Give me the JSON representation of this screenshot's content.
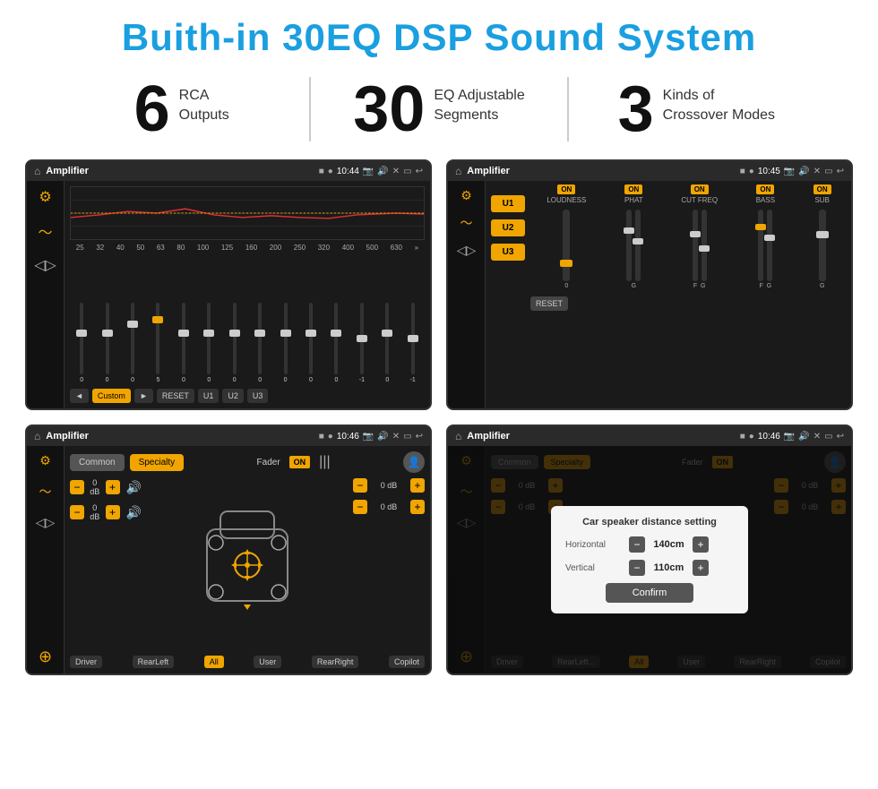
{
  "title": "Buith-in 30EQ DSP Sound System",
  "stats": [
    {
      "number": "6",
      "label": "RCA\nOutputs"
    },
    {
      "number": "30",
      "label": "EQ Adjustable\nSegments"
    },
    {
      "number": "3",
      "label": "Kinds of\nCrossover Modes"
    }
  ],
  "screens": [
    {
      "id": "eq-screen",
      "statusBar": {
        "appTitle": "Amplifier",
        "time": "10:44"
      },
      "eqBands": [
        "25",
        "32",
        "40",
        "50",
        "63",
        "80",
        "100",
        "125",
        "160",
        "200",
        "250",
        "320",
        "400",
        "500",
        "630"
      ],
      "eqValues": [
        "0",
        "0",
        "0",
        "5",
        "0",
        "0",
        "0",
        "0",
        "0",
        "0",
        "0",
        "-1",
        "0",
        "-1"
      ],
      "bottomButtons": [
        "◄",
        "Custom",
        "►",
        "RESET",
        "U1",
        "U2",
        "U3"
      ]
    },
    {
      "id": "amp-screen",
      "statusBar": {
        "appTitle": "Amplifier",
        "time": "10:45"
      },
      "uButtons": [
        "U1",
        "U2",
        "U3"
      ],
      "controls": [
        {
          "on": true,
          "label": "LOUDNESS"
        },
        {
          "on": true,
          "label": "PHAT"
        },
        {
          "on": true,
          "label": "CUT FREQ"
        },
        {
          "on": true,
          "label": "BASS"
        },
        {
          "on": true,
          "label": "SUB"
        }
      ],
      "resetLabel": "RESET"
    },
    {
      "id": "fader-screen",
      "statusBar": {
        "appTitle": "Amplifier",
        "time": "10:46"
      },
      "tabs": [
        "Common",
        "Specialty"
      ],
      "faderLabel": "Fader",
      "faderOn": "ON",
      "leftControls": [
        {
          "value": "0 dB"
        },
        {
          "value": "0 dB"
        }
      ],
      "rightControls": [
        {
          "value": "0 dB"
        },
        {
          "value": "0 dB"
        }
      ],
      "bottomLabels": [
        "Driver",
        "RearLeft",
        "All",
        "User",
        "RearRight",
        "Copilot"
      ]
    },
    {
      "id": "dialog-screen",
      "statusBar": {
        "appTitle": "Amplifier",
        "time": "10:46"
      },
      "tabs": [
        "Common",
        "Specialty"
      ],
      "dialog": {
        "title": "Car speaker distance setting",
        "rows": [
          {
            "label": "Horizontal",
            "value": "140cm"
          },
          {
            "label": "Vertical",
            "value": "110cm"
          }
        ],
        "confirmLabel": "Confirm"
      },
      "rightControls": [
        {
          "value": "0 dB"
        },
        {
          "value": "0 dB"
        }
      ],
      "bottomLabels": [
        "Driver",
        "RearLeft",
        "All",
        "User",
        "RearRight",
        "Copilot"
      ]
    }
  ]
}
